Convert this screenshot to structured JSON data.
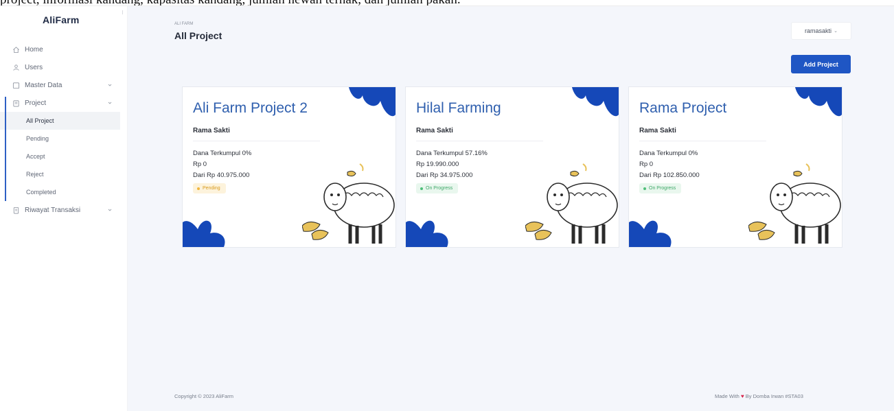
{
  "caption": "project, informasi kandang, kapasitas kandang, jumlah hewan ternak, dan jumlah pakan.",
  "brand": "AliFarm",
  "sidebar": {
    "items": [
      {
        "label": "Home",
        "icon": "home-icon"
      },
      {
        "label": "Users",
        "icon": "users-icon"
      },
      {
        "label": "Master Data",
        "icon": "folder-icon"
      },
      {
        "label": "Project",
        "icon": "clipboard-icon"
      }
    ],
    "project_sub": [
      "All Project",
      "Pending",
      "Accept",
      "Reject",
      "Completed"
    ],
    "last": {
      "label": "Riwayat Transaksi",
      "icon": "receipt-icon"
    }
  },
  "header": {
    "breadcrumb": "ALI FARM",
    "title": "All Project",
    "user": "ramasakti",
    "add_button": "Add Project"
  },
  "projects": [
    {
      "title": "Ali Farm Project 2",
      "owner": "Rama Sakti",
      "collected": "Dana Terkumpul 0%",
      "amount": "Rp 0",
      "target": "Dari Rp 40.975.000",
      "status": "Pending"
    },
    {
      "title": "Hilal Farming",
      "owner": "Rama Sakti",
      "collected": "Dana Terkumpul 57.16%",
      "amount": "Rp 19.990.000",
      "target": "Dari Rp 34.975.000",
      "status": "On Progress"
    },
    {
      "title": "Rama Project",
      "owner": "Rama Sakti",
      "collected": "Dana Terkumpul 0%",
      "amount": "Rp 0",
      "target": "Dari Rp 102.850.000",
      "status": "On Progress"
    }
  ],
  "footer": {
    "copyright": "Copyright © 2023 AliFarm",
    "made_with": "Made With",
    "heart": "♥",
    "by": "By Domba Irwan #STA03"
  },
  "colors": {
    "accent": "#1f56c4",
    "blob": "#1548b8",
    "title": "#2f5fae"
  }
}
